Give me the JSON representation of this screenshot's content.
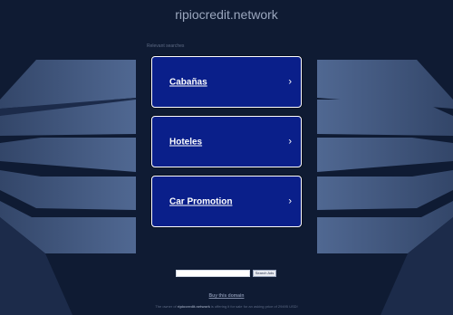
{
  "header": {
    "site_name": "ripiocredit.network"
  },
  "searches": {
    "heading": "Relevant searches",
    "items": [
      {
        "label": "Cabañas"
      },
      {
        "label": "Hoteles"
      },
      {
        "label": "Car Promotion"
      }
    ]
  },
  "search_bar": {
    "value": "",
    "button_label": "Search Ads"
  },
  "footer": {
    "buy_label": "Buy this domain",
    "sale_prefix": "The owner of ",
    "sale_domain": "ripiocredit.network",
    "sale_suffix": " is offering it for sale for an asking price of 29495 USD!"
  },
  "colors": {
    "background": "#0f1b33",
    "card_fill": "#0a1f8a",
    "card_border": "#ffffff",
    "panel_light": "#4a5f86",
    "panel_dark": "#2e3f63"
  }
}
